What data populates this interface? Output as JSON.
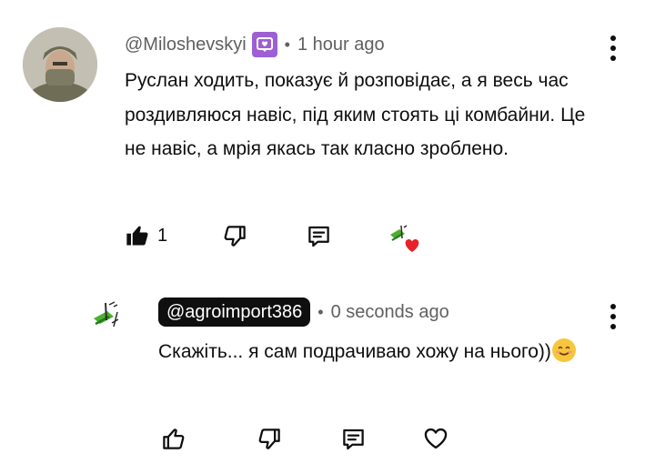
{
  "top_comment": {
    "username": "@Miloshevskyi",
    "separator": "•",
    "time": "1 hour ago",
    "text": "Руслан ходить, показує й розповідає, а я весь час роздивляюся навіс, під яким стоять ці комбайни. Це не навіс, а мрія якась  так класно зроблено.",
    "like_count": "1",
    "icons": {
      "badge": "member-badge-icon",
      "menu": "more-vert-icon",
      "like": "thumbs-up-filled-icon",
      "dislike": "thumbs-down-icon",
      "reply": "reply-comment-icon",
      "hearted": "creator-heart-icon"
    }
  },
  "reply": {
    "username": "@agroimport386",
    "separator": "•",
    "time": "0 seconds ago",
    "text": "Скажіть... я сам подрачиваю хожу на нього))",
    "icons": {
      "emoji": "smiling-face-icon",
      "menu": "more-vert-icon",
      "like": "thumbs-up-icon",
      "dislike": "thumbs-down-icon",
      "reply": "reply-comment-icon",
      "heart": "heart-outline-icon"
    }
  },
  "colors": {
    "text": "#0f0f0f",
    "meta": "#606060",
    "badge": "#9d5fd3",
    "heart": "#e8212a",
    "logo_green": "#4caf2e"
  }
}
